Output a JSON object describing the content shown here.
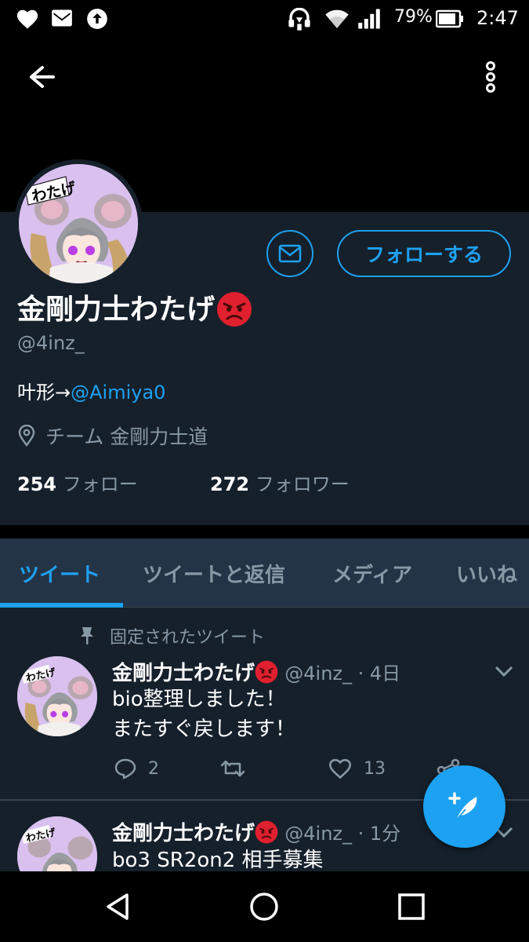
{
  "status_bar": {
    "battery_percent": "79%",
    "time": "2:47",
    "left_icons": [
      "heart-icon",
      "gmail-icon",
      "upload-icon"
    ],
    "right_icons": [
      "headset-icon",
      "wifi-icon",
      "signal-icon",
      "battery-icon"
    ]
  },
  "profile": {
    "display_name": "金剛力士わたげ",
    "handle": "@4inz_",
    "bio_text": "叶形→",
    "bio_mention": "@Aimiya0",
    "location": "チーム 金剛力士道",
    "following_count": "254",
    "following_label": "フォロー",
    "followers_count": "272",
    "followers_label": "フォロワー",
    "follow_button": "フォローする",
    "avatar_text": "わたげ"
  },
  "tabs": [
    {
      "label": "ツイート",
      "active": true
    },
    {
      "label": "ツイートと返信",
      "active": false
    },
    {
      "label": "メディア",
      "active": false
    },
    {
      "label": "いいね",
      "active": false
    }
  ],
  "pinned_label": "固定されたツイート",
  "tweets": [
    {
      "name": "金剛力士わたげ",
      "meta": "@4inz_ · 4日",
      "lines": [
        "bio整理しました！",
        "またすぐ戻します！"
      ],
      "replies": "2",
      "retweets": "",
      "likes": "13"
    },
    {
      "name": "金剛力士わたげ",
      "meta": "@4inz_ · 1分",
      "lines": [
        "bo3 SR2on2 相手募集"
      ],
      "replies": "",
      "retweets": "",
      "likes": ""
    }
  ],
  "colors": {
    "accent": "#1da1f2",
    "background": "#15202b",
    "secondary_text": "#8899a6",
    "emoji_red": "#e0202e"
  }
}
